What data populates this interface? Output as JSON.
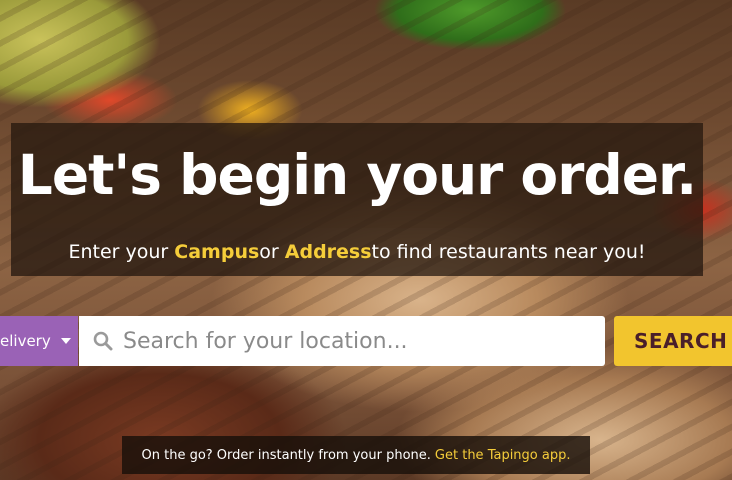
{
  "hero": {
    "title": "Let's begin your order.",
    "subtitle_pre": "Enter your ",
    "subtitle_campus": "Campus",
    "subtitle_or": " or ",
    "subtitle_address": "Address",
    "subtitle_post": " to find restaurants near you!"
  },
  "search": {
    "mode_label": "elivery",
    "placeholder": "Search for your location...",
    "value": "",
    "button_label": "SEARCH"
  },
  "promo": {
    "text": "On the go? Order instantly from your phone.",
    "link_label": "Get the Tapingo app."
  },
  "colors": {
    "mode_select_bg": "#9a62b6",
    "search_button_bg": "#f2c52e",
    "highlight": "#f5cd3a"
  },
  "icons": {
    "search": "magnifier-icon",
    "dropdown": "caret-down-icon"
  }
}
